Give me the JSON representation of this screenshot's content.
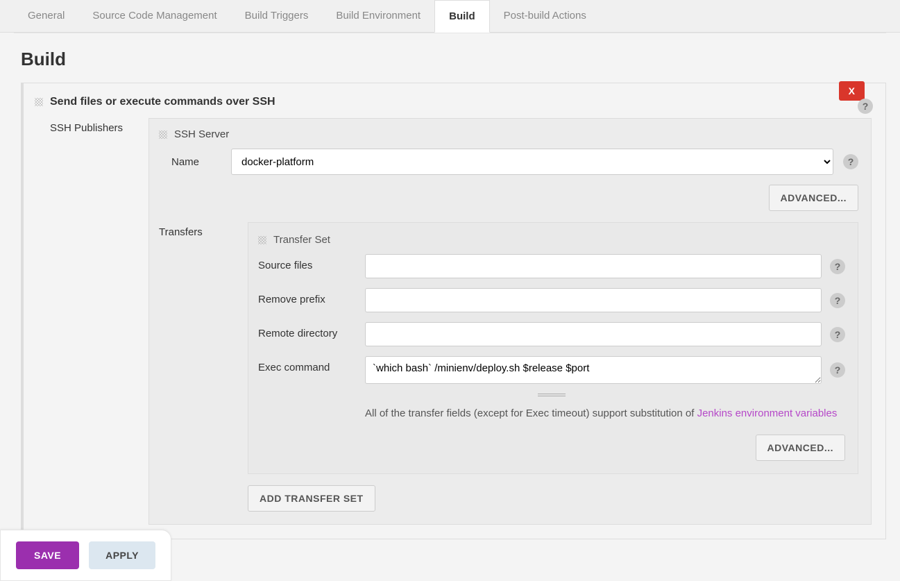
{
  "tabs": {
    "general": "General",
    "scm": "Source Code Management",
    "triggers": "Build Triggers",
    "environment": "Build Environment",
    "build": "Build",
    "postbuild": "Post-build Actions"
  },
  "page_title": "Build",
  "section_header": "Send files or execute commands over SSH",
  "close_label": "X",
  "ssh_publishers_label": "SSH Publishers",
  "ssh_server": {
    "panel_title": "SSH Server",
    "name_label": "Name",
    "name_value": "docker-platform",
    "advanced_label": "ADVANCED..."
  },
  "transfers_label": "Transfers",
  "transfer_set": {
    "panel_title": "Transfer Set",
    "source_files_label": "Source files",
    "source_files_value": "",
    "remove_prefix_label": "Remove prefix",
    "remove_prefix_value": "",
    "remote_directory_label": "Remote directory",
    "remote_directory_value": "",
    "exec_command_label": "Exec command",
    "exec_command_value": "`which bash` /minienv/deploy.sh $release $port",
    "note_prefix": "All of the transfer fields (except for Exec timeout) support substitution of ",
    "note_link": "Jenkins environment variables",
    "advanced_label": "ADVANCED..."
  },
  "add_transfer_label": "ADD TRANSFER SET",
  "footer": {
    "save": "SAVE",
    "apply": "APPLY"
  }
}
